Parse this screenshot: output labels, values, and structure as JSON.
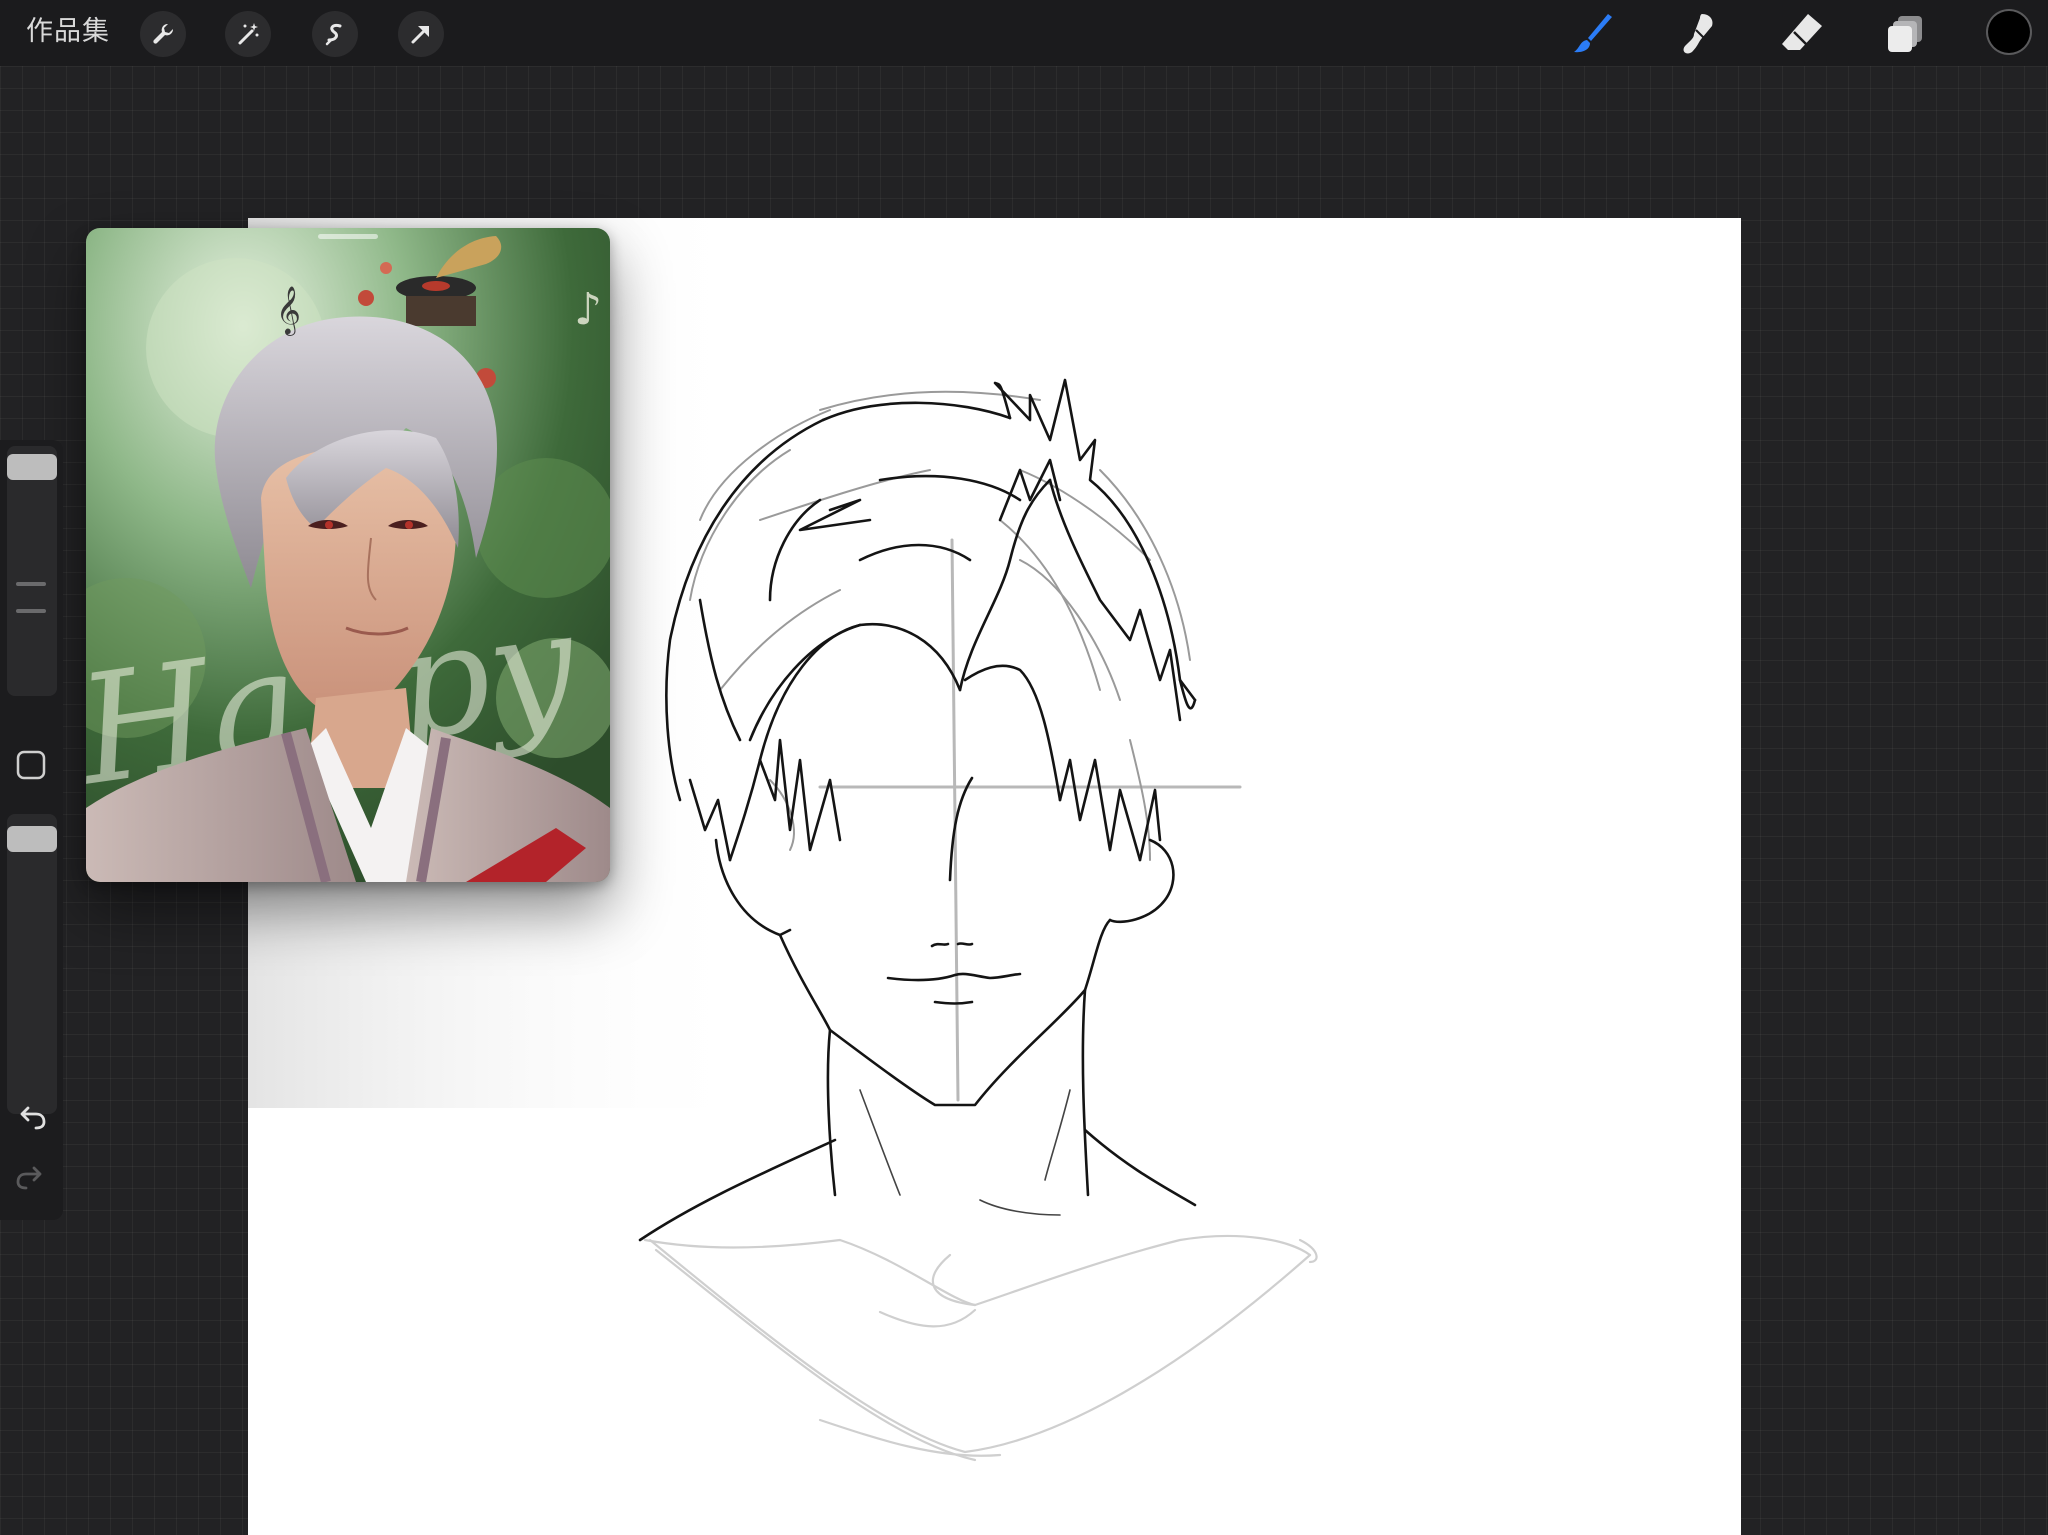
{
  "toolbar": {
    "gallery_label": "作品集",
    "left_tools": [
      "wrench-icon",
      "magic-wand-icon",
      "selection-icon",
      "transform-arrow-icon"
    ],
    "right_tools": [
      "brush-icon",
      "smudge-icon",
      "eraser-icon",
      "layers-icon"
    ],
    "active_tool": "brush-icon",
    "accent_color": "#2b7cf6",
    "current_color": "#000000"
  },
  "sidebar": {
    "brush_size_level": 0.95,
    "opacity_level": 0.95,
    "buttons": [
      "modify-square-icon",
      "undo-icon",
      "redo-icon"
    ]
  },
  "reference": {
    "overlay_text": "Happy Birthday"
  }
}
